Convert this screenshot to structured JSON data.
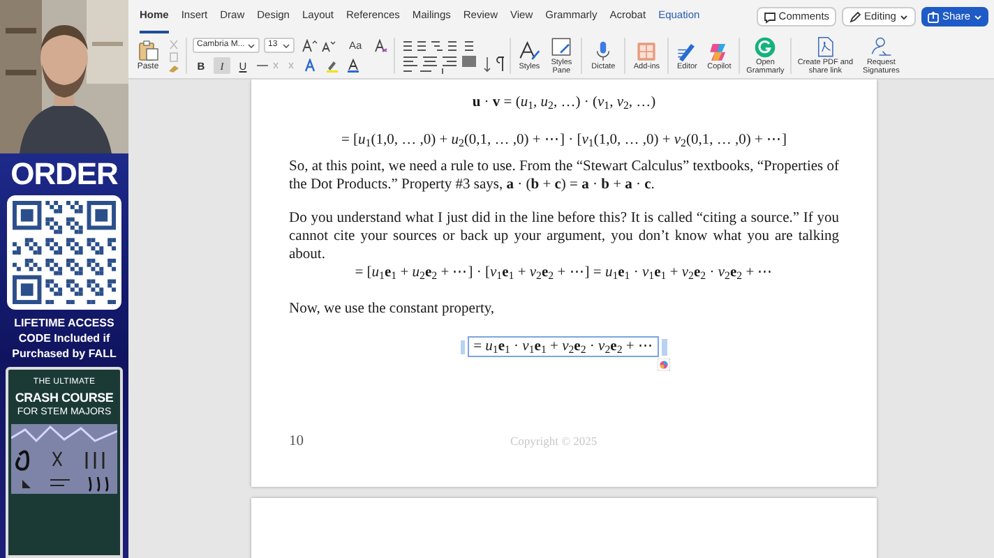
{
  "promo": {
    "heading": "ORDER",
    "note": "LIFETIME ACCESS CODE Included if Purchased by FALL",
    "book": {
      "kicker": "THE ULTIMATE",
      "title": "CRASH COURSE",
      "subtitle": "FOR STEM MAJORS"
    }
  },
  "ribbon": {
    "tabs": [
      {
        "label": "Home",
        "selected": true,
        "kind": "standard"
      },
      {
        "label": "Insert",
        "selected": false,
        "kind": "standard"
      },
      {
        "label": "Draw",
        "selected": false,
        "kind": "standard"
      },
      {
        "label": "Design",
        "selected": false,
        "kind": "standard"
      },
      {
        "label": "Layout",
        "selected": false,
        "kind": "standard"
      },
      {
        "label": "References",
        "selected": false,
        "kind": "standard"
      },
      {
        "label": "Mailings",
        "selected": false,
        "kind": "standard"
      },
      {
        "label": "Review",
        "selected": false,
        "kind": "standard"
      },
      {
        "label": "View",
        "selected": false,
        "kind": "standard"
      },
      {
        "label": "Grammarly",
        "selected": false,
        "kind": "standard"
      },
      {
        "label": "Acrobat",
        "selected": false,
        "kind": "standard"
      },
      {
        "label": "Equation",
        "selected": false,
        "kind": "contextual"
      }
    ],
    "actions": [
      {
        "label": "Comments",
        "kind": "comments"
      },
      {
        "label": "Editing",
        "kind": "editing"
      },
      {
        "label": "Share",
        "kind": "share"
      }
    ],
    "paste": "Paste",
    "font": {
      "name": "Cambria M...",
      "size": "13"
    },
    "case_button": "Aa",
    "format_buttons": [
      {
        "kind": "bold",
        "label": "B",
        "selected": false
      },
      {
        "kind": "italic",
        "label": "I",
        "selected": true
      },
      {
        "kind": "underline",
        "label": "U",
        "selected": false
      }
    ],
    "groups": [
      {
        "kind": "styles",
        "label": "Styles"
      },
      {
        "kind": "styles_pane",
        "label": "Styles Pane"
      },
      {
        "kind": "dictate",
        "label": "Dictate"
      },
      {
        "kind": "addins",
        "label": "Add-ins"
      },
      {
        "kind": "editor",
        "label": "Editor"
      },
      {
        "kind": "copilot",
        "label": "Copilot"
      },
      {
        "kind": "grammarly",
        "label": "Open Grammarly"
      },
      {
        "kind": "pdf",
        "label": "Create PDF and share link"
      },
      {
        "kind": "signatures",
        "label": "Request Signatures"
      }
    ]
  },
  "document": {
    "blocks": [
      {
        "kind": "equation",
        "text": "**u** · **v** = (*u*$_{1}$, *u*$_{2}$, …) · (*v*$_{1}$, *v*$_{2}$, …)"
      },
      {
        "kind": "equation",
        "text": "= [*u*$_{1}$(1,0, … ,0) + *u*$_{2}$(0,1, … ,0) + ⋯] · [*v*$_{1}$(1,0, … ,0) + *v*$_{2}$(0,1, … ,0) + ⋯]"
      },
      {
        "kind": "paragraph",
        "text": "So, at this point, we need a rule to use. From the “Stewart Calculus” textbooks, “Properties of the Dot Products.” Property #3 says, **a** · (**b** + **c**) = **a** · **b** + **a** · **c**."
      },
      {
        "kind": "paragraph",
        "text": "Do you understand what I just did in the line before this? It is called “citing a source.” If you cannot cite your sources or back up your argument, you don’t know what you are talking about."
      },
      {
        "kind": "equation",
        "text": "= [*u*$_{1}$**e**$_{1}$ + *u*$_{2}$**e**$_{2}$ + ⋯] · [*v*$_{1}$**e**$_{1}$ + *v*$_{2}$**e**$_{2}$ + ⋯] = *u*$_{1}$**e**$_{1}$ · *v*$_{1}$**e**$_{1}$ + *v*$_{2}$**e**$_{2}$ · *v*$_{2}$**e**$_{2}$ + ⋯"
      },
      {
        "kind": "paragraph",
        "text": "Now, we use the constant property,"
      },
      {
        "kind": "equation_editing",
        "text": "= *u*$_{1}$**e**$_{1}$ · *v*$_{1}$**e**$_{1}$ + *v*$_{2}$**e**$_{2}$ · *v*$_{2}$**e**$_{2}$ + ⋯"
      }
    ],
    "footer": {
      "page_number": "10",
      "copyright": "Copyright © 2025"
    }
  }
}
